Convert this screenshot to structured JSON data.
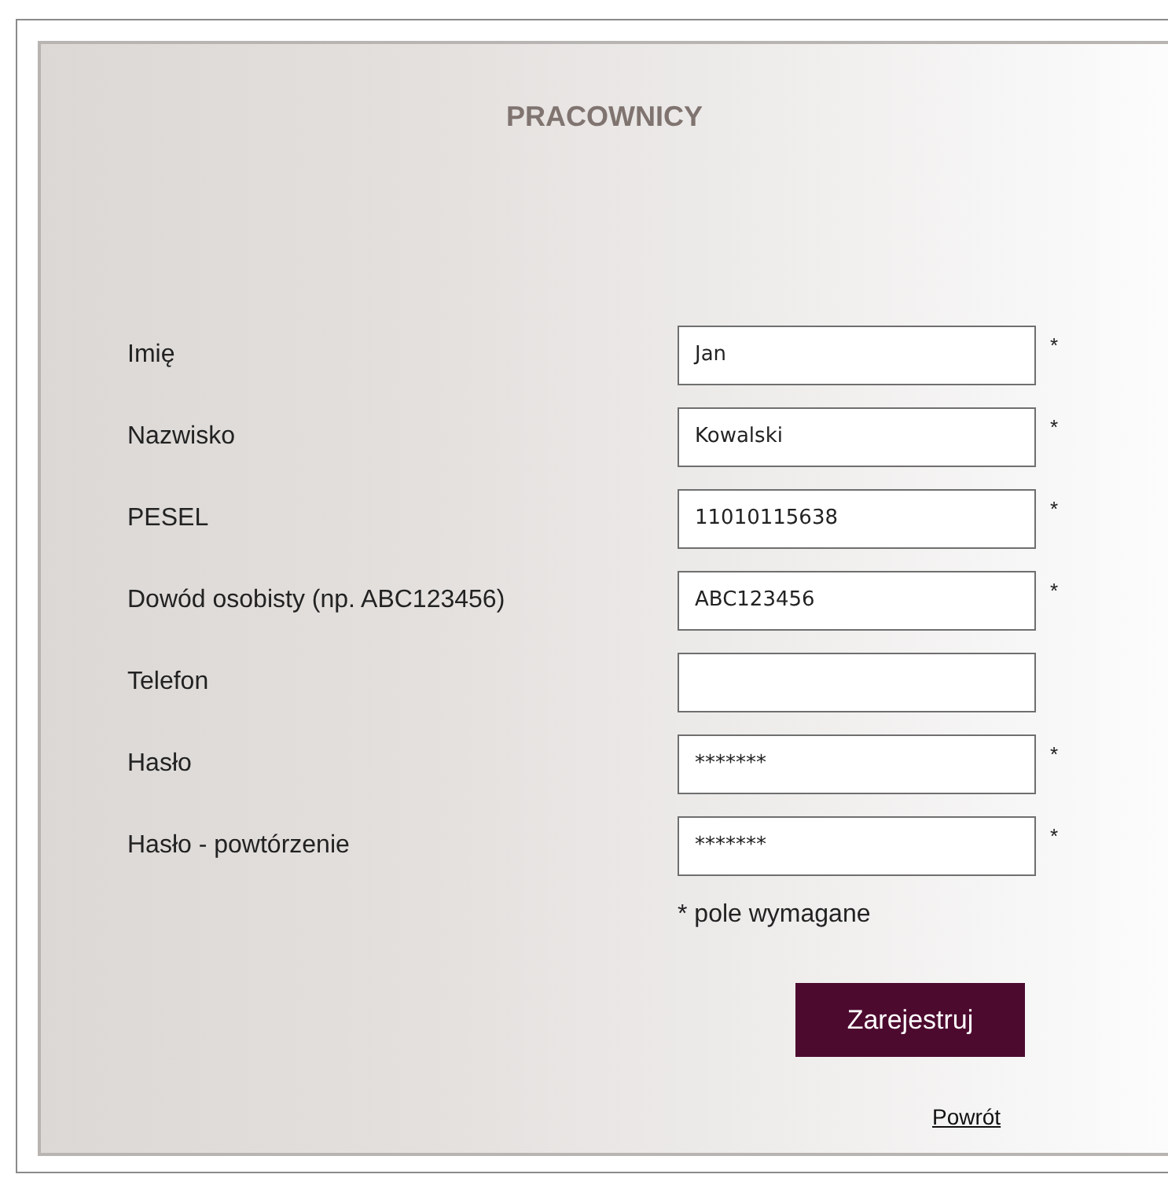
{
  "title": "PRACOWNICY",
  "fields": [
    {
      "label": "Imię",
      "value": "Jan",
      "mark": "*"
    },
    {
      "label": "Nazwisko",
      "value": "Kowalski",
      "mark": "*"
    },
    {
      "label": "PESEL",
      "value": "11010115638",
      "mark": "*"
    },
    {
      "label": "Dowód osobisty (np. ABC123456)",
      "value": "ABC123456",
      "mark": "*"
    },
    {
      "label": "Telefon"
    },
    {
      "label": "Hasło",
      "value": "*******",
      "mark": "*"
    },
    {
      "label": "Hasło - powtórzenie",
      "value": "*******",
      "mark": "*"
    }
  ],
  "note": "* pole wymagane",
  "submit": "Zarejestruj",
  "back_link": "Powrót"
}
